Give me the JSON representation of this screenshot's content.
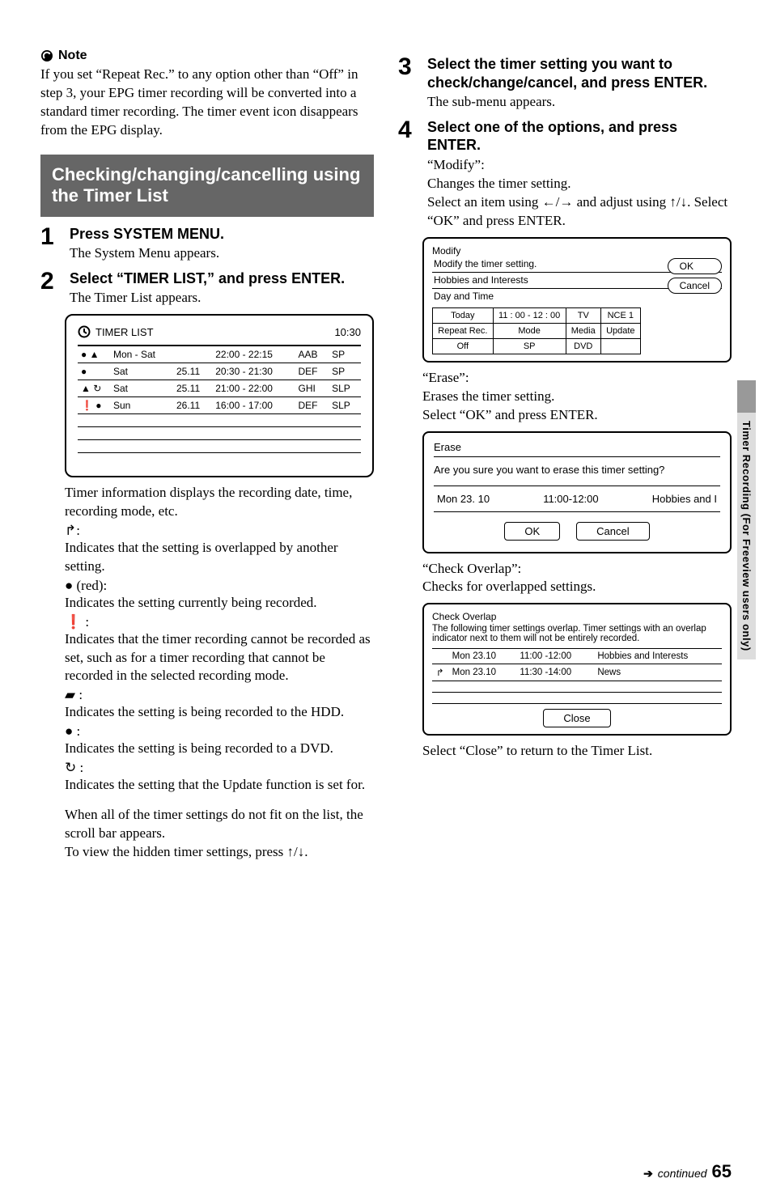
{
  "note": {
    "label": "Note",
    "text": "If you set “Repeat Rec.” to any option other than “Off” in step 3, your EPG timer recording will be converted into a standard timer recording. The timer event icon disappears from the EPG display."
  },
  "section_title": "Checking/changing/cancelling using the Timer List",
  "steps_left": {
    "s1": {
      "num": "1",
      "title": "Press SYSTEM MENU.",
      "sub": "The System Menu appears."
    },
    "s2": {
      "num": "2",
      "title": "Select “TIMER LIST,” and press ENTER.",
      "sub": "The Timer List appears."
    }
  },
  "timer_list_panel": {
    "title": "TIMER LIST",
    "clock": "10:30",
    "rows": [
      {
        "icons": "● ▲",
        "day": "Mon - Sat",
        "date": "",
        "time": "22:00 - 22:15",
        "ch": "AAB",
        "mode": "SP"
      },
      {
        "icons": "●",
        "day": "Sat",
        "date": "25.11",
        "time": "20:30 - 21:30",
        "ch": "DEF",
        "mode": "SP"
      },
      {
        "icons": "▲ ↻",
        "day": "Sat",
        "date": "25.11",
        "time": "21:00 - 22:00",
        "ch": "GHI",
        "mode": "SLP"
      },
      {
        "icons": "❗ ●",
        "day": "Sun",
        "date": "26.11",
        "time": "16:00 - 17:00",
        "ch": "DEF",
        "mode": "SLP"
      }
    ]
  },
  "left_desc": {
    "intro": "Timer information displays the recording date, time, recording mode, etc.",
    "overlap_icon": "↱:",
    "overlap": "Indicates that the setting is overlapped by another setting.",
    "red_icon": "● (red):",
    "red": "Indicates the setting currently being recorded.",
    "warn_icon": "❗ :",
    "warn": "Indicates that the timer recording cannot be recorded as set, such as for a timer recording that cannot be recorded in the selected recording mode.",
    "hdd_icon": "▰ :",
    "hdd": "Indicates the setting is being recorded to the HDD.",
    "dvd_icon": "● :",
    "dvd": "Indicates the setting is being recorded to a DVD.",
    "upd_icon": "↻ :",
    "upd": "Indicates the setting that the Update function is set for.",
    "scroll1": "When all of the timer settings do not fit on the list, the scroll bar appears.",
    "scroll2": "To view the hidden timer settings, press ↑/↓."
  },
  "steps_right": {
    "s3": {
      "num": "3",
      "title": "Select the timer setting you want to check/change/cancel, and press ENTER.",
      "sub": "The sub-menu appears."
    },
    "s4": {
      "num": "4",
      "title": "Select one of the options, and press ENTER."
    }
  },
  "modify": {
    "label": "“Modify”:",
    "l1": "Changes the timer setting.",
    "l2": "Select an item using ←/→ and adjust using ↑/↓. Select “OK” and press ENTER.",
    "panel_title": "Modify",
    "panel_sub": "Modify the timer setting.",
    "hobbies": "Hobbies and Interests",
    "dayandtime": "Day and Time",
    "ok": "OK",
    "cancel": "Cancel",
    "row_today": "Today",
    "row_time": "11 : 00  -  12 : 00",
    "row_tv": "TV",
    "row_nce": "NCE 1",
    "h_repeat": "Repeat Rec.",
    "h_mode": "Mode",
    "h_media": "Media",
    "h_update": "Update",
    "v_off": "Off",
    "v_sp": "SP",
    "v_dvd": "DVD",
    "v_blank": ""
  },
  "erase": {
    "label": "“Erase”:",
    "l1": "Erases the timer setting.",
    "l2": "Select “OK” and press ENTER.",
    "panel_title": "Erase",
    "q": "Are you sure you want to erase this timer setting?",
    "row_date": "Mon 23. 10",
    "row_time": "11:00-12:00",
    "row_name": "Hobbies and I",
    "ok": "OK",
    "cancel": "Cancel"
  },
  "overlap": {
    "label": "“Check Overlap”:",
    "l1": "Checks for overlapped settings.",
    "panel_title": "Check Overlap",
    "desc": "The following timer settings overlap. Timer settings with an overlap indicator next to them will not be entirely recorded.",
    "r1_date": "Mon 23.10",
    "r1_time": "11:00 -12:00",
    "r1_name": "Hobbies and Interests",
    "r2_icon": "↱",
    "r2_date": "Mon 23.10",
    "r2_time": "11:30 -14:00",
    "r2_name": "News",
    "close": "Close",
    "after": "Select “Close” to return to the Timer List."
  },
  "side_tab": "Timer Recording (For Freeview users only)",
  "footer": {
    "arrow": "➔",
    "continued": "continued",
    "page": "65"
  }
}
